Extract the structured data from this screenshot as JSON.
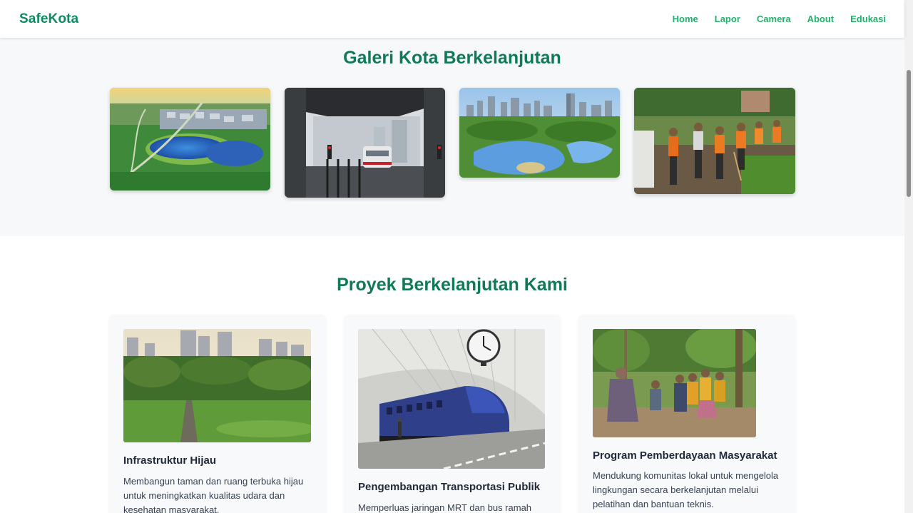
{
  "navbar": {
    "brand": "SafeKota",
    "links": [
      "Home",
      "Lapor",
      "Camera",
      "About",
      "Edukasi"
    ]
  },
  "gallery": {
    "title": "Galeri Kota Berkelanjutan"
  },
  "projects": {
    "title": "Proyek Berkelanjutan Kami",
    "cards": [
      {
        "title": "Infrastruktur Hijau",
        "description": "Membangun taman dan ruang terbuka hijau untuk meningkatkan kualitas udara dan kesehatan masyarakat."
      },
      {
        "title": "Pengembangan Transportasi Publik",
        "description": "Memperluas jaringan MRT dan bus ramah"
      },
      {
        "title": "Program Pemberdayaan Masyarakat",
        "description": "Mendukung komunitas lokal untuk mengelola lingkungan secara berkelanjutan melalui pelatihan dan bantuan teknis."
      }
    ]
  },
  "colors": {
    "brand": "#0f8a5f",
    "nav_link": "#22b06a",
    "heading": "#0f7a55",
    "section_bg": "#f6f8fa"
  }
}
